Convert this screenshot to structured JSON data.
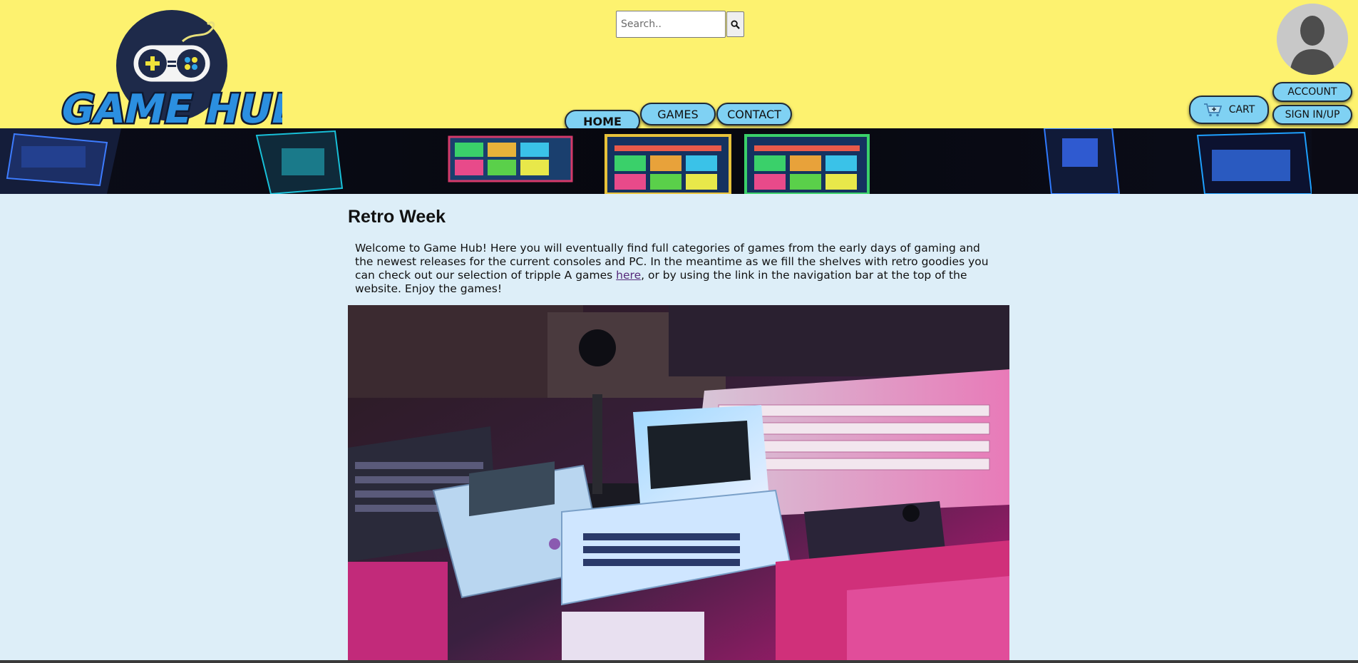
{
  "header": {
    "logo_text": "GAME HUB",
    "search": {
      "placeholder": "Search.."
    },
    "nav": [
      {
        "label": "HOME",
        "active": true
      },
      {
        "label": "GAMES",
        "active": false
      },
      {
        "label": "CONTACT",
        "active": false
      }
    ],
    "cart_label": "CART",
    "account_label": "ACCOUNT",
    "signin_label": "SIGN IN/UP"
  },
  "main": {
    "title": "Retro Week",
    "intro_before": "Welcome to Game Hub! Here you will eventually find full categories of games from the early days of gaming and the newest releases for the current consoles and PC. In the meantime as we fill the shelves with retro goodies you can check out our selection of tripple A games ",
    "intro_link": "here",
    "intro_after": ", or by using the link in the navigation bar at the top of the website. Enjoy the games!"
  },
  "colors": {
    "header_bg": "#fdf26f",
    "page_bg": "#ddeef8",
    "nav_button": "#7fd1f3",
    "link": "#55297a"
  },
  "icons": [
    "search-icon",
    "cart-icon",
    "user-avatar-icon",
    "gamepad-logo"
  ]
}
